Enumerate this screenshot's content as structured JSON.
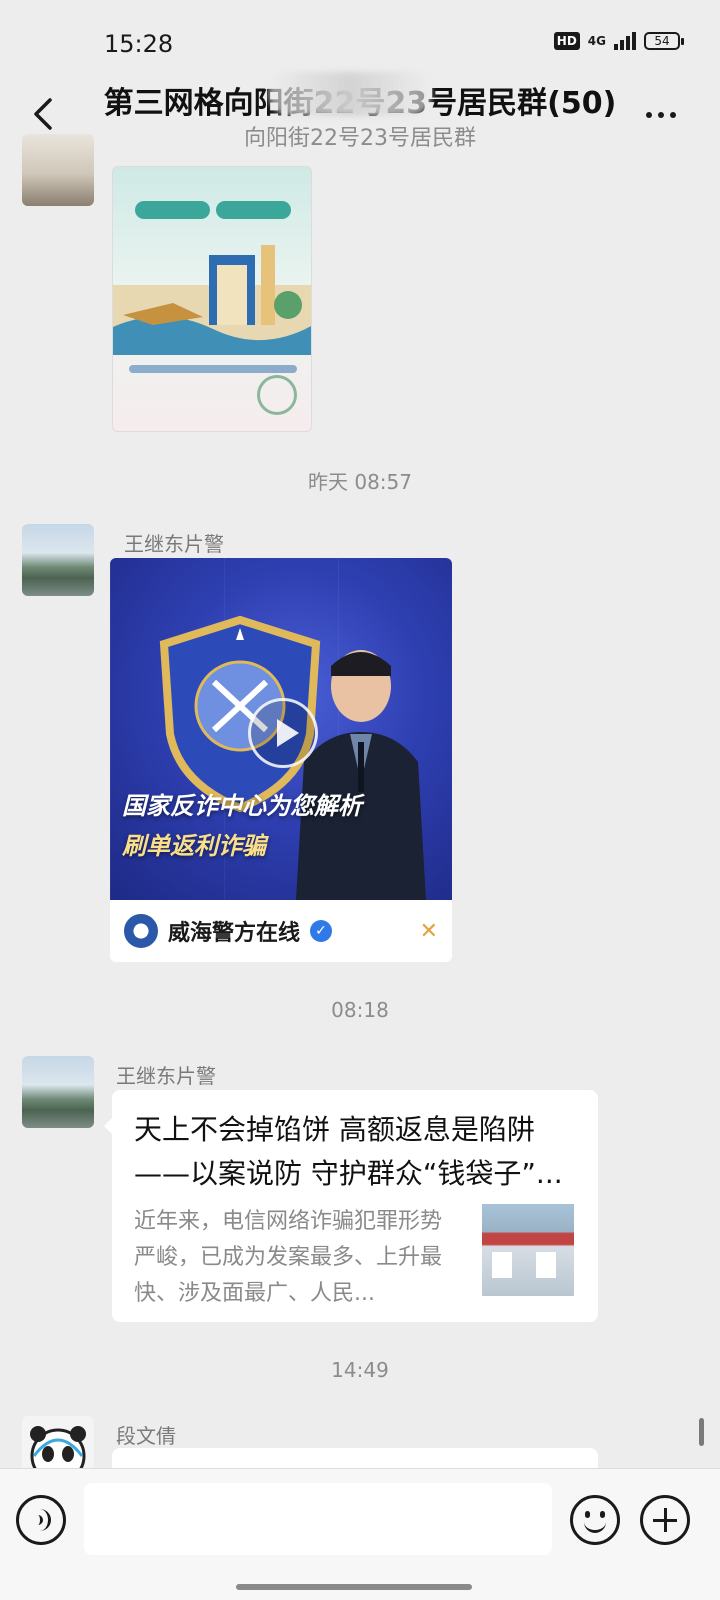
{
  "status_bar": {
    "time": "15:28",
    "hd": "HD",
    "network": "4G",
    "battery": "54"
  },
  "header": {
    "title": "第三网格向阳街22号23号居民群(50)",
    "subtitle": "向阳街22号23号居民群"
  },
  "messages": {
    "poster": {
      "sender": "",
      "image_alt": "poster image",
      "colors": {
        "accent": "#3aa79a"
      }
    },
    "timestamp_1": "昨天 08:57",
    "video": {
      "sender": "王继东片警",
      "caption_line1": "国家反诈中心为您解析",
      "caption_line2": "刷单返利诈骗",
      "source_name": "威海警方在线",
      "verified_icon": "verified-check-icon",
      "channels_icon": "channels-icon"
    },
    "timestamp_2": "08:18",
    "article": {
      "sender": "王继东片警",
      "title": "天上不会掉馅饼 高额返息是陷阱——以案说防 守护群众“钱袋子”...",
      "description": "近年来，电信网络诈骗犯罪形势严峻，已成为发案最多、上升最快、涉及面最广、人民..."
    },
    "timestamp_3": "14:49",
    "last": {
      "sender": "段文倩"
    }
  },
  "input_bar": {
    "voice_icon": "voice-icon",
    "emoji_icon": "emoji-icon",
    "plus_icon": "plus-icon",
    "placeholder": ""
  }
}
